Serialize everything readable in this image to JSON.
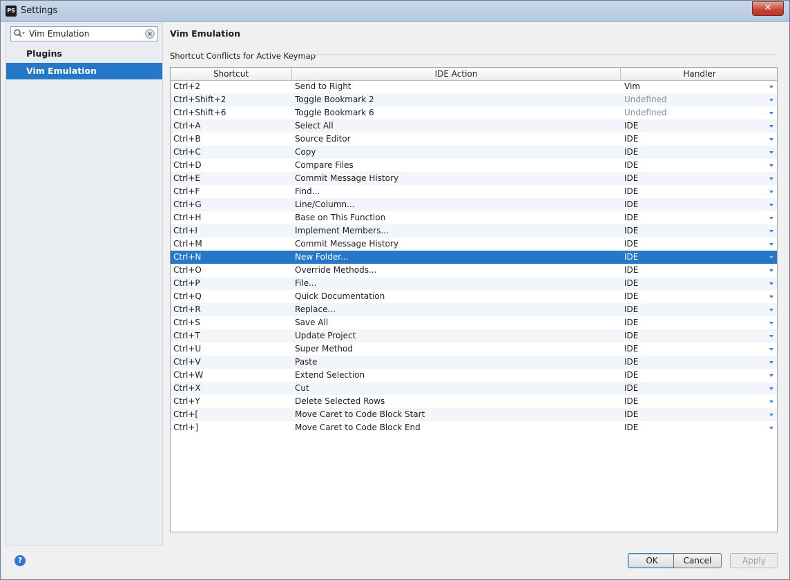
{
  "window": {
    "title": "Settings",
    "app_icon": "PS",
    "close_symbol": "✕"
  },
  "search": {
    "value": "Vim Emulation"
  },
  "sidebar": {
    "items": [
      {
        "label": "Plugins"
      },
      {
        "label": "Vim Emulation",
        "selected": true
      }
    ]
  },
  "main": {
    "title": "Vim Emulation",
    "section_title": "Shortcut Conflicts for Active Keymap",
    "columns": [
      "Shortcut",
      "IDE Action",
      "Handler"
    ],
    "rows": [
      {
        "shortcut": "Ctrl+2",
        "action": "Send to Right",
        "handler": "Vim"
      },
      {
        "shortcut": "Ctrl+Shift+2",
        "action": "Toggle Bookmark 2",
        "handler": "Undefined"
      },
      {
        "shortcut": "Ctrl+Shift+6",
        "action": "Toggle Bookmark 6",
        "handler": "Undefined"
      },
      {
        "shortcut": "Ctrl+A",
        "action": "Select All",
        "handler": "IDE"
      },
      {
        "shortcut": "Ctrl+B",
        "action": "Source Editor",
        "handler": "IDE"
      },
      {
        "shortcut": "Ctrl+C",
        "action": "Copy",
        "handler": "IDE"
      },
      {
        "shortcut": "Ctrl+D",
        "action": "Compare Files",
        "handler": "IDE"
      },
      {
        "shortcut": "Ctrl+E",
        "action": "Commit Message History",
        "handler": "IDE"
      },
      {
        "shortcut": "Ctrl+F",
        "action": "Find...",
        "handler": "IDE"
      },
      {
        "shortcut": "Ctrl+G",
        "action": "Line/Column...",
        "handler": "IDE"
      },
      {
        "shortcut": "Ctrl+H",
        "action": "Base on This Function",
        "handler": "IDE"
      },
      {
        "shortcut": "Ctrl+I",
        "action": "Implement Members...",
        "handler": "IDE"
      },
      {
        "shortcut": "Ctrl+M",
        "action": "Commit Message History",
        "handler": "IDE"
      },
      {
        "shortcut": "Ctrl+N",
        "action": "New Folder...",
        "handler": "IDE",
        "selected": true
      },
      {
        "shortcut": "Ctrl+O",
        "action": "Override Methods...",
        "handler": "IDE"
      },
      {
        "shortcut": "Ctrl+P",
        "action": "File...",
        "handler": "IDE"
      },
      {
        "shortcut": "Ctrl+Q",
        "action": "Quick Documentation",
        "handler": "IDE"
      },
      {
        "shortcut": "Ctrl+R",
        "action": "Replace...",
        "handler": "IDE"
      },
      {
        "shortcut": "Ctrl+S",
        "action": "Save All",
        "handler": "IDE"
      },
      {
        "shortcut": "Ctrl+T",
        "action": "Update Project",
        "handler": "IDE"
      },
      {
        "shortcut": "Ctrl+U",
        "action": "Super Method",
        "handler": "IDE"
      },
      {
        "shortcut": "Ctrl+V",
        "action": "Paste",
        "handler": "IDE"
      },
      {
        "shortcut": "Ctrl+W",
        "action": "Extend Selection",
        "handler": "IDE"
      },
      {
        "shortcut": "Ctrl+X",
        "action": "Cut",
        "handler": "IDE"
      },
      {
        "shortcut": "Ctrl+Y",
        "action": "Delete Selected Rows",
        "handler": "IDE"
      },
      {
        "shortcut": "Ctrl+[",
        "action": "Move Caret to Code Block Start",
        "handler": "IDE"
      },
      {
        "shortcut": "Ctrl+]",
        "action": "Move Caret to Code Block End",
        "handler": "IDE"
      }
    ]
  },
  "footer": {
    "help_label": "?",
    "ok_label": "OK",
    "cancel_label": "Cancel",
    "apply_label": "Apply"
  },
  "colors": {
    "selection": "#2577c8",
    "dropdown_arrow": "#3b7dd8"
  }
}
